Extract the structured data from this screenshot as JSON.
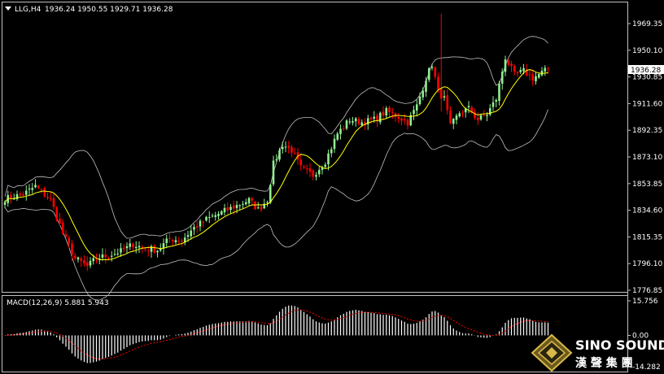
{
  "header": {
    "symbol": "LLG,H4",
    "ohlc": "1936.24 1950.55 1929.71 1936.28"
  },
  "macd_header": "MACD(12,26,9) 5.881 5.943",
  "current_price_label": "1936.28",
  "colors": {
    "bull": "#90ee90",
    "bear": "#ff0000",
    "ma": "#ffff00",
    "bands": "#c0c0c0",
    "hist": "#ffffff",
    "signal": "#ff0000"
  },
  "logo": {
    "line1": "SINO SOUND",
    "line2": "漢 聲 集 團"
  },
  "chart_data": [
    {
      "type": "candlestick",
      "title": "LLG,H4",
      "ylim": [
        1776.85,
        1982
      ],
      "price_ticks": [
        "1969.35",
        "1950.10",
        "1930.85",
        "1911.60",
        "1892.35",
        "1873.10",
        "1853.85",
        "1834.60",
        "1815.35",
        "1796.10",
        "1776.85"
      ],
      "price_tick_values": [
        1969.35,
        1950.1,
        1930.85,
        1911.6,
        1892.35,
        1873.1,
        1853.85,
        1834.6,
        1815.35,
        1796.1,
        1776.85
      ],
      "indicators": [
        "Bollinger Bands",
        "Moving Average"
      ],
      "close_anchors": [
        [
          0,
          1843
        ],
        [
          6,
          1846
        ],
        [
          10,
          1852
        ],
        [
          15,
          1842
        ],
        [
          19,
          1818
        ],
        [
          23,
          1800
        ],
        [
          27,
          1794
        ],
        [
          30,
          1800
        ],
        [
          34,
          1802
        ],
        [
          38,
          1805
        ],
        [
          42,
          1810
        ],
        [
          46,
          1807
        ],
        [
          50,
          1806
        ],
        [
          54,
          1814
        ],
        [
          58,
          1813
        ],
        [
          62,
          1822
        ],
        [
          66,
          1828
        ],
        [
          70,
          1832
        ],
        [
          74,
          1836
        ],
        [
          78,
          1840
        ],
        [
          80,
          1842
        ],
        [
          83,
          1835
        ],
        [
          86,
          1842
        ],
        [
          88,
          1868
        ],
        [
          91,
          1882
        ],
        [
          94,
          1878
        ],
        [
          97,
          1865
        ],
        [
          101,
          1860
        ],
        [
          105,
          1870
        ],
        [
          109,
          1890
        ],
        [
          113,
          1900
        ],
        [
          117,
          1898
        ],
        [
          121,
          1900
        ],
        [
          125,
          1906
        ],
        [
          129,
          1902
        ],
        [
          132,
          1898
        ],
        [
          135,
          1910
        ],
        [
          138,
          1930
        ],
        [
          140,
          1940
        ],
        [
          142,
          1920
        ],
        [
          144,
          1915
        ],
        [
          146,
          1895
        ],
        [
          149,
          1905
        ],
        [
          152,
          1908
        ],
        [
          155,
          1900
        ],
        [
          158,
          1904
        ],
        [
          161,
          1915
        ],
        [
          164,
          1945
        ],
        [
          167,
          1932
        ],
        [
          170,
          1935
        ],
        [
          173,
          1930
        ],
        [
          176,
          1934
        ],
        [
          178,
          1936.28
        ]
      ],
      "spike": {
        "bar": 143,
        "high": 1976.5,
        "low": 1906
      }
    },
    {
      "type": "bar",
      "title": "MACD(12,26,9) 5.881 5.943",
      "ylim": [
        -14.282,
        15.756
      ],
      "ticks": [
        "15.756",
        "0.00",
        "-14.282"
      ],
      "tick_values": [
        15.756,
        0,
        -14.282
      ],
      "series": [
        {
          "name": "MACD",
          "values_note": "histogram"
        },
        {
          "name": "Signal",
          "values_note": "dotted line"
        }
      ],
      "current": {
        "macd": 5.881,
        "signal": 5.943
      }
    }
  ]
}
